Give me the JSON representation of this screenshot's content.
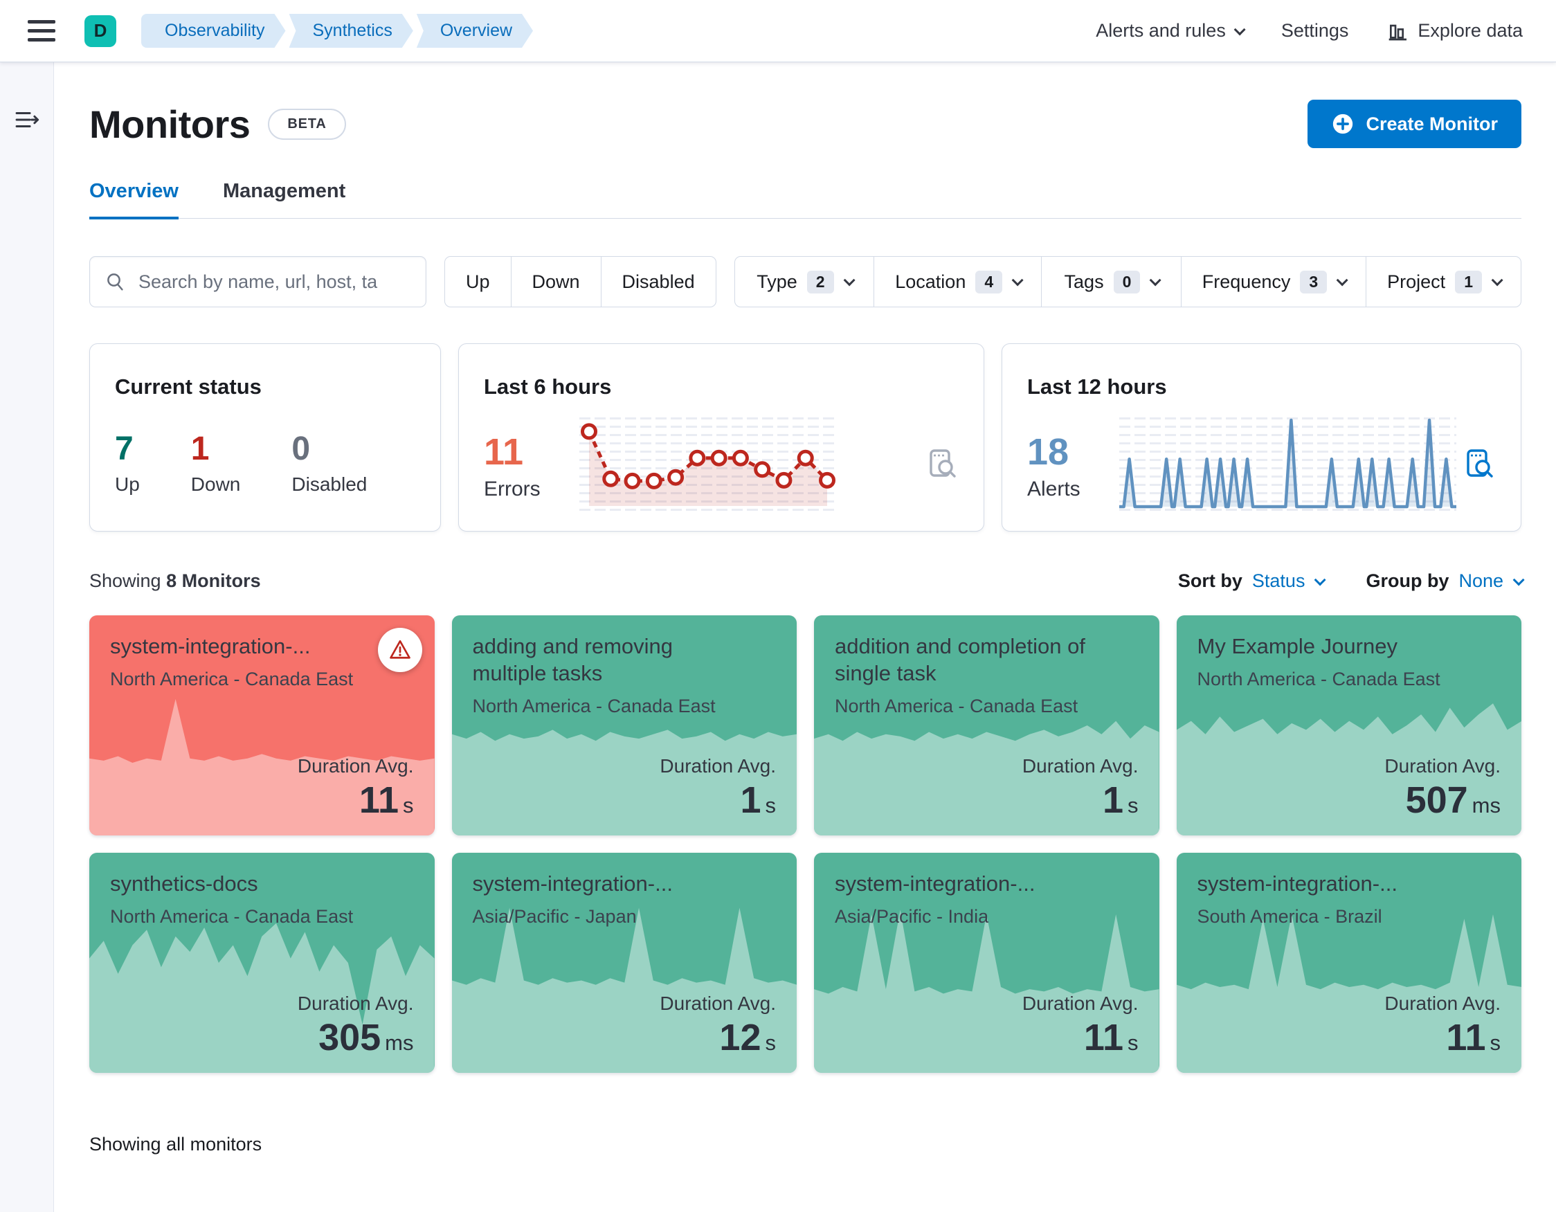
{
  "header": {
    "space_initial": "D",
    "breadcrumbs": [
      "Observability",
      "Synthetics",
      "Overview"
    ],
    "alerts_menu": "Alerts and rules",
    "settings": "Settings",
    "explore_data": "Explore data"
  },
  "page": {
    "title": "Monitors",
    "beta_badge": "BETA",
    "create_button": "Create Monitor",
    "tab_overview": "Overview",
    "tab_management": "Management"
  },
  "filters": {
    "search_placeholder": "Search by name, url, host, ta",
    "status": [
      "Up",
      "Down",
      "Disabled"
    ],
    "dropdowns": [
      {
        "label": "Type",
        "count": "2"
      },
      {
        "label": "Location",
        "count": "4"
      },
      {
        "label": "Tags",
        "count": "0"
      },
      {
        "label": "Frequency",
        "count": "3"
      },
      {
        "label": "Project",
        "count": "1"
      }
    ]
  },
  "overview_stats": {
    "current_status": {
      "title": "Current status",
      "up": {
        "value": "7",
        "label": "Up"
      },
      "down": {
        "value": "1",
        "label": "Down"
      },
      "disabled": {
        "value": "0",
        "label": "Disabled"
      }
    },
    "last_6_hours": {
      "title": "Last 6 hours",
      "value": "11",
      "label": "Errors"
    },
    "last_12_hours": {
      "title": "Last 12 hours",
      "value": "18",
      "label": "Alerts"
    }
  },
  "chart_data": [
    {
      "type": "line",
      "title": "Last 6 hours",
      "series": [
        {
          "name": "Errors",
          "values": [
            10,
            3.4,
            3.1,
            3.1,
            3.6,
            6.3,
            6.3,
            6.3,
            4.7,
            3.2,
            6.3,
            3.2
          ]
        }
      ],
      "x": [
        1,
        2,
        3,
        4,
        5,
        6,
        7,
        8,
        9,
        10,
        11,
        12
      ],
      "ylim": [
        0,
        11
      ],
      "style": "dashed red line, open circle markers, shaded area, axes hidden",
      "color": "#BD271E"
    },
    {
      "type": "line",
      "title": "Last 12 hours",
      "series": [
        {
          "name": "Alerts",
          "spikes": [
            [
              3,
              55
            ],
            [
              14,
              55
            ],
            [
              18,
              55
            ],
            [
              26,
              55
            ],
            [
              30,
              55
            ],
            [
              34,
              55
            ],
            [
              38,
              55
            ],
            [
              51,
              100
            ],
            [
              63,
              55
            ],
            [
              71,
              55
            ],
            [
              75,
              55
            ],
            [
              80,
              55
            ],
            [
              87,
              55
            ],
            [
              92,
              100
            ],
            [
              97,
              55
            ]
          ],
          "baseline": 0
        }
      ],
      "note": "spikes given as [x_percent, height_percent] over a flat baseline, axes hidden",
      "color": "#6092C0"
    }
  ],
  "list_controls": {
    "showing_prefix": "Showing",
    "showing_strong": "8 Monitors",
    "sort_by_label": "Sort by",
    "sort_by_value": "Status",
    "group_by_label": "Group by",
    "group_by_value": "None",
    "footer": "Showing all monitors"
  },
  "monitors": [
    {
      "title": "system-integration-...",
      "location": "North America - Canada East",
      "duration_label": "Duration Avg.",
      "value": "11",
      "unit": "s",
      "status": "down",
      "spark": [
        35,
        34,
        36,
        33,
        35,
        34,
        62,
        35,
        34,
        36,
        34,
        35,
        37,
        35,
        34,
        36,
        35,
        34,
        36,
        35,
        34,
        36,
        35,
        34,
        35
      ]
    },
    {
      "title": "adding and removing multiple tasks",
      "location": "North America - Canada East",
      "duration_label": "Duration Avg.",
      "value": "1",
      "unit": "s",
      "status": "up",
      "spark": [
        46,
        44,
        47,
        43,
        46,
        44,
        45,
        48,
        44,
        46,
        43,
        47,
        45,
        44,
        46,
        48,
        44,
        45,
        47,
        43,
        46,
        44,
        47,
        45,
        46
      ]
    },
    {
      "title": "addition and completion of single task",
      "location": "North America - Canada East",
      "duration_label": "Duration Avg.",
      "value": "1",
      "unit": "s",
      "status": "up",
      "spark": [
        44,
        46,
        43,
        47,
        44,
        46,
        45,
        43,
        47,
        44,
        46,
        44,
        47,
        45,
        43,
        46,
        48,
        45,
        47,
        50,
        46,
        52,
        44,
        50,
        47
      ]
    },
    {
      "title": "My Example Journey",
      "location": "North America - Canada East",
      "duration_label": "Duration Avg.",
      "value": "507",
      "unit": "ms",
      "status": "up",
      "spark": [
        48,
        52,
        46,
        54,
        47,
        50,
        53,
        46,
        51,
        48,
        53,
        47,
        52,
        48,
        54,
        46,
        50,
        55,
        47,
        58,
        49,
        55,
        60,
        48,
        52
      ]
    },
    {
      "title": "synthetics-docs",
      "location": "North America - Canada East",
      "duration_label": "Duration Avg.",
      "value": "305",
      "unit": "ms",
      "status": "up",
      "spark": [
        52,
        60,
        45,
        58,
        65,
        48,
        62,
        55,
        66,
        50,
        58,
        44,
        62,
        68,
        52,
        64,
        46,
        58,
        50,
        22,
        56,
        62,
        44,
        58,
        52
      ]
    },
    {
      "title": "system-integration-...",
      "location": "Asia/Pacific - Japan",
      "duration_label": "Duration Avg.",
      "value": "12",
      "unit": "s",
      "status": "up",
      "spark": [
        42,
        40,
        43,
        41,
        75,
        42,
        40,
        43,
        41,
        42,
        40,
        43,
        41,
        75,
        42,
        40,
        43,
        41,
        42,
        40,
        75,
        43,
        41,
        42,
        40
      ]
    },
    {
      "title": "system-integration-...",
      "location": "Asia/Pacific - India",
      "duration_label": "Duration Avg.",
      "value": "11",
      "unit": "s",
      "status": "up",
      "spark": [
        38,
        36,
        39,
        37,
        72,
        38,
        74,
        37,
        39,
        36,
        38,
        37,
        72,
        39,
        36,
        38,
        37,
        39,
        36,
        38,
        37,
        72,
        39,
        37,
        38
      ]
    },
    {
      "title": "system-integration-...",
      "location": "South America - Brazil",
      "duration_label": "Duration Avg.",
      "value": "11",
      "unit": "s",
      "status": "up",
      "spark": [
        40,
        38,
        41,
        39,
        40,
        38,
        70,
        39,
        72,
        40,
        38,
        41,
        39,
        40,
        38,
        41,
        39,
        40,
        38,
        41,
        70,
        39,
        72,
        40,
        39
      ]
    }
  ],
  "colors": {
    "primary_blue": "#0077CC",
    "selected_tab_blue": "#0071C2",
    "breadcrumb_bg": "#D9E9F8",
    "breadcrumb_text": "#0A6DBB",
    "space_avatar_teal": "#0FBFB3",
    "up_card_green": "#54B399",
    "down_card_red": "#F6726B",
    "status_up_text": "#017066",
    "status_down_text": "#BD271E",
    "status_disabled_text": "#69707D",
    "errors_value": "#E7664C",
    "alerts_value": "#6092C0",
    "panel_border": "#D3DAE6"
  }
}
